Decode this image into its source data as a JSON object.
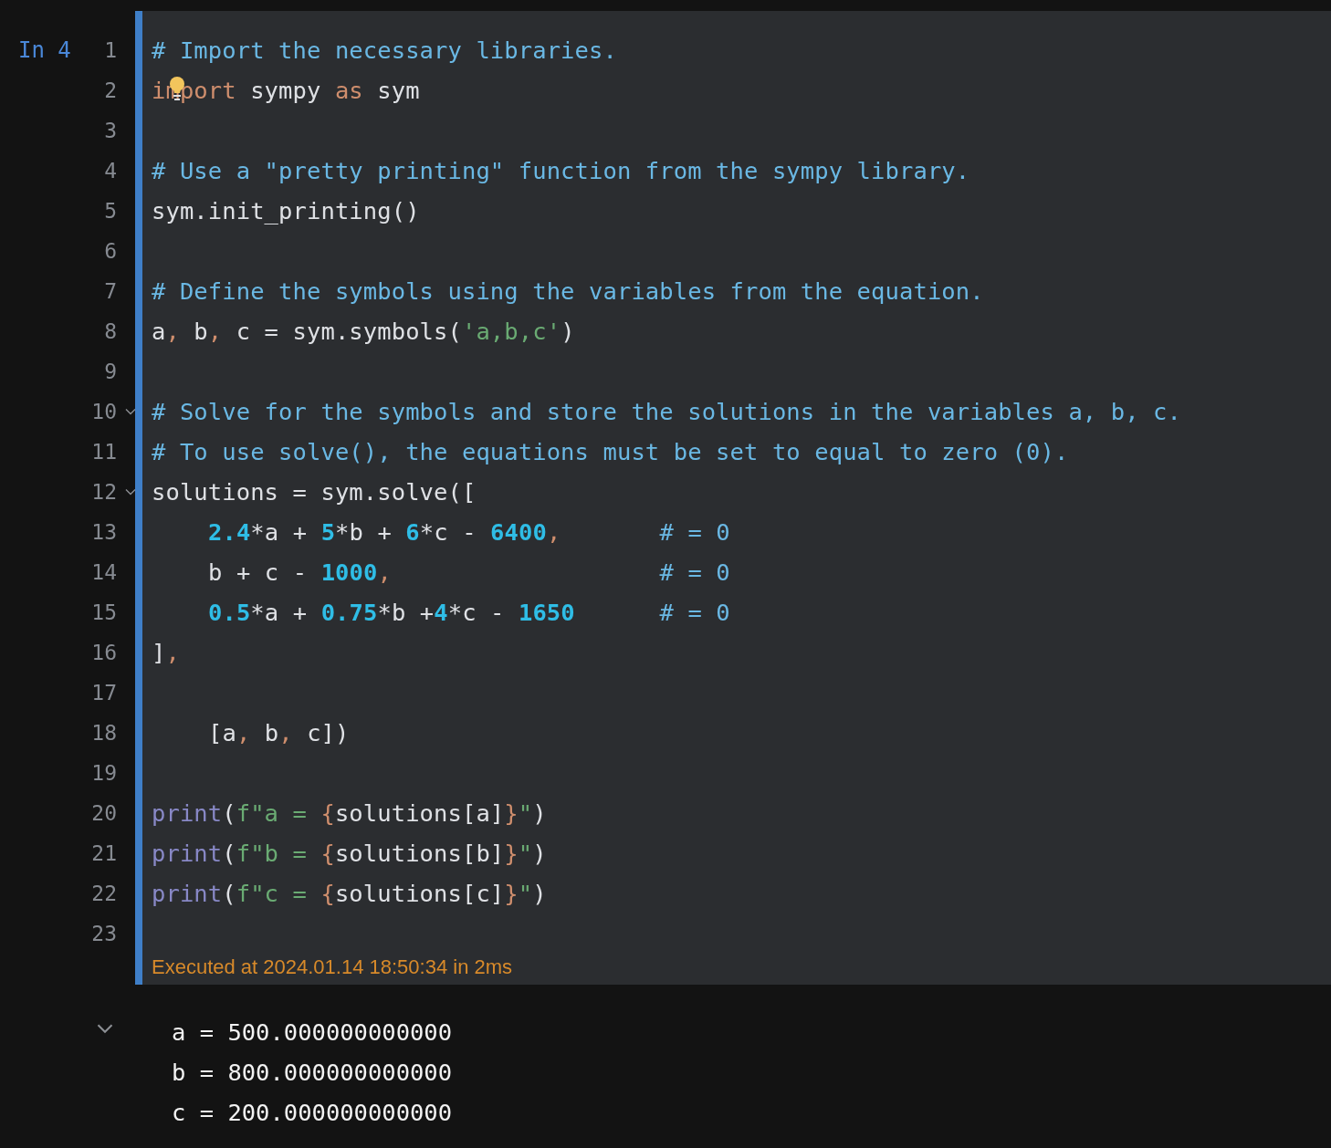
{
  "cell": {
    "prompt": "In 4",
    "lines": [
      {
        "number": "1",
        "foldable": false,
        "hint": false,
        "tokens": [
          {
            "kind": "comment",
            "text": "# Import the necessary libraries."
          }
        ]
      },
      {
        "number": "2",
        "foldable": false,
        "hint": true,
        "tokens": [
          {
            "kind": "keyword",
            "text": "import"
          },
          {
            "kind": "plain",
            "text": " sympy "
          },
          {
            "kind": "keyword",
            "text": "as"
          },
          {
            "kind": "plain",
            "text": " sym"
          }
        ]
      },
      {
        "number": "3",
        "foldable": false,
        "hint": false
      },
      {
        "number": "4",
        "foldable": false,
        "hint": false,
        "tokens": [
          {
            "kind": "comment",
            "text": "# Use a \"pretty printing\" function from the sympy library."
          }
        ]
      },
      {
        "number": "5",
        "foldable": false,
        "hint": false,
        "tokens": [
          {
            "kind": "plain",
            "text": "sym.init_printing()"
          }
        ]
      },
      {
        "number": "6",
        "foldable": false,
        "hint": false
      },
      {
        "number": "7",
        "foldable": false,
        "hint": false,
        "tokens": [
          {
            "kind": "comment",
            "text": "# Define the symbols using the variables from the equation."
          }
        ]
      },
      {
        "number": "8",
        "foldable": false,
        "hint": false,
        "tokens": [
          {
            "kind": "plain",
            "text": "a"
          },
          {
            "kind": "punct",
            "text": ","
          },
          {
            "kind": "plain",
            "text": " b"
          },
          {
            "kind": "punct",
            "text": ","
          },
          {
            "kind": "plain",
            "text": " c = sym.symbols("
          },
          {
            "kind": "string",
            "text": "'a,b,c'"
          },
          {
            "kind": "plain",
            "text": ")"
          }
        ]
      },
      {
        "number": "9",
        "foldable": false,
        "hint": false
      },
      {
        "number": "10",
        "foldable": true,
        "hint": false,
        "tokens": [
          {
            "kind": "comment",
            "text": "# Solve for the symbols and store the solutions in the variables a, b, c."
          }
        ]
      },
      {
        "number": "11",
        "foldable": false,
        "hint": false,
        "tokens": [
          {
            "kind": "comment",
            "text": "# To use solve(), the equations must be set to equal to zero (0)."
          }
        ]
      },
      {
        "number": "12",
        "foldable": true,
        "hint": false,
        "tokens": [
          {
            "kind": "plain",
            "text": "solutions = sym.solve(["
          }
        ]
      },
      {
        "number": "13",
        "foldable": false,
        "hint": false,
        "indent": true,
        "tokens": [
          {
            "kind": "number",
            "text": "2.4"
          },
          {
            "kind": "plain",
            "text": "*a + "
          },
          {
            "kind": "number",
            "text": "5"
          },
          {
            "kind": "plain",
            "text": "*b + "
          },
          {
            "kind": "number",
            "text": "6"
          },
          {
            "kind": "plain",
            "text": "*c - "
          },
          {
            "kind": "number",
            "text": "6400"
          },
          {
            "kind": "punct",
            "text": ","
          },
          {
            "kind": "comment",
            "text": "       # = 0"
          }
        ]
      },
      {
        "number": "14",
        "foldable": false,
        "hint": false,
        "indent": true,
        "tokens": [
          {
            "kind": "plain",
            "text": "b + c - "
          },
          {
            "kind": "number",
            "text": "1000"
          },
          {
            "kind": "punct",
            "text": ","
          },
          {
            "kind": "comment",
            "text": "                   # = 0"
          }
        ]
      },
      {
        "number": "15",
        "foldable": false,
        "hint": false,
        "indent": true,
        "tokens": [
          {
            "kind": "number",
            "text": "0.5"
          },
          {
            "kind": "plain",
            "text": "*a + "
          },
          {
            "kind": "number",
            "text": "0.75"
          },
          {
            "kind": "plain",
            "text": "*b +"
          },
          {
            "kind": "number",
            "text": "4"
          },
          {
            "kind": "plain",
            "text": "*c - "
          },
          {
            "kind": "number",
            "text": "1650"
          },
          {
            "kind": "comment",
            "text": "      # = 0"
          }
        ]
      },
      {
        "number": "16",
        "foldable": false,
        "hint": false,
        "tokens": [
          {
            "kind": "plain",
            "text": "]"
          },
          {
            "kind": "punct",
            "text": ","
          }
        ]
      },
      {
        "number": "17",
        "foldable": false,
        "hint": false
      },
      {
        "number": "18",
        "foldable": false,
        "hint": false,
        "indent": true,
        "tokens": [
          {
            "kind": "plain",
            "text": "[a"
          },
          {
            "kind": "punct",
            "text": ","
          },
          {
            "kind": "plain",
            "text": " b"
          },
          {
            "kind": "punct",
            "text": ","
          },
          {
            "kind": "plain",
            "text": " c])"
          }
        ]
      },
      {
        "number": "19",
        "foldable": false,
        "hint": false
      },
      {
        "number": "20",
        "foldable": false,
        "hint": false,
        "tokens": [
          {
            "kind": "builtin",
            "text": "print"
          },
          {
            "kind": "plain",
            "text": "("
          },
          {
            "kind": "string",
            "text": "f\"a = "
          },
          {
            "kind": "brace",
            "text": "{"
          },
          {
            "kind": "plain",
            "text": "solutions[a]"
          },
          {
            "kind": "brace",
            "text": "}"
          },
          {
            "kind": "string",
            "text": "\""
          },
          {
            "kind": "plain",
            "text": ")"
          }
        ]
      },
      {
        "number": "21",
        "foldable": false,
        "hint": false,
        "tokens": [
          {
            "kind": "builtin",
            "text": "print"
          },
          {
            "kind": "plain",
            "text": "("
          },
          {
            "kind": "string",
            "text": "f\"b = "
          },
          {
            "kind": "brace",
            "text": "{"
          },
          {
            "kind": "plain",
            "text": "solutions[b]"
          },
          {
            "kind": "brace",
            "text": "}"
          },
          {
            "kind": "string",
            "text": "\""
          },
          {
            "kind": "plain",
            "text": ")"
          }
        ]
      },
      {
        "number": "22",
        "foldable": false,
        "hint": false,
        "tokens": [
          {
            "kind": "builtin",
            "text": "print"
          },
          {
            "kind": "plain",
            "text": "("
          },
          {
            "kind": "string",
            "text": "f\"c = "
          },
          {
            "kind": "brace",
            "text": "{"
          },
          {
            "kind": "plain",
            "text": "solutions[c]"
          },
          {
            "kind": "brace",
            "text": "}"
          },
          {
            "kind": "string",
            "text": "\""
          },
          {
            "kind": "plain",
            "text": ")"
          }
        ]
      },
      {
        "number": "23",
        "foldable": false,
        "hint": false
      }
    ],
    "execution_info": "Executed at 2024.01.14 18:50:34 in 2ms"
  },
  "output": {
    "expanded": true,
    "lines": [
      "a = 500.000000000000",
      "b = 800.000000000000",
      "c = 200.000000000000"
    ]
  }
}
